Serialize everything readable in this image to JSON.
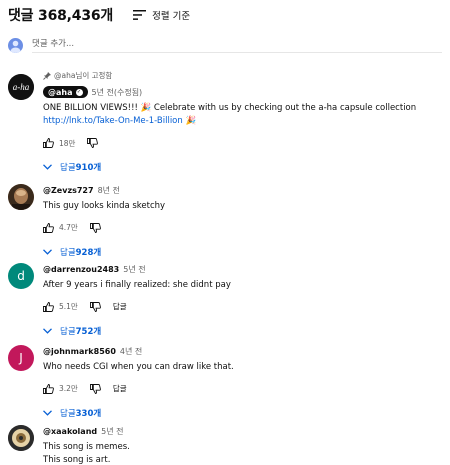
{
  "header": {
    "count_label": "댓글 368,436개",
    "sort_label": "정렬 기준"
  },
  "add_comment": {
    "placeholder": "댓글 추가..."
  },
  "comments": [
    {
      "pinned_label": "@aha님이 고정함",
      "author": "@aha",
      "time": "5년 전(수정됨)",
      "text_part1": "ONE BILLION VIEWS!!! 🎉 Celebrate with us by checking out the a-ha capsule collection ",
      "link": "http://lnk.to/Take-On-Me-1-Billion",
      "text_part2": " 🎉",
      "likes": "18만",
      "replies_prefix": "답글 ",
      "replies_count": "910개",
      "avatar_text": "a-ha"
    },
    {
      "author": "@Zevzs727",
      "time": "8년 전",
      "text": "This guy looks kinda sketchy",
      "likes": "4.7만",
      "replies_prefix": "답글 ",
      "replies_count": "928개"
    },
    {
      "author": "@darrenzou2483",
      "time": "5년 전",
      "text": "After 9 years i finally realized: she didnt pay",
      "likes": "5.1만",
      "reply_label": "답글",
      "replies_prefix": "답글 ",
      "replies_count": "752개",
      "avatar_letter": "d",
      "avatar_color": "#00897b"
    },
    {
      "author": "@johnmark8560",
      "time": "4년 전",
      "text": "Who needs CGI when you can draw like that.",
      "likes": "3.2만",
      "reply_label": "답글",
      "replies_prefix": "답글 ",
      "replies_count": "330개",
      "avatar_letter": "J",
      "avatar_color": "#c2185b"
    },
    {
      "author": "@xaakoland",
      "time": "5년 전",
      "line1": "This song is memes.",
      "line2": "This song is art."
    }
  ]
}
